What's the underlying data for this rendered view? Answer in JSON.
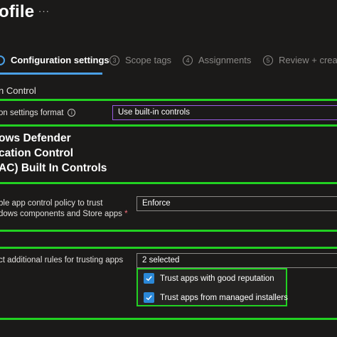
{
  "header": {
    "title": "ofile",
    "more_icon": "ellipsis-icon"
  },
  "steps": [
    {
      "number": "",
      "label": "Configuration settings",
      "active": true
    },
    {
      "number": "3",
      "label": "Scope tags"
    },
    {
      "number": "4",
      "label": "Assignments"
    },
    {
      "number": "5",
      "label": "Review + create"
    }
  ],
  "section": {
    "label": "n Control"
  },
  "format_field": {
    "label": "on settings format",
    "info_icon": "info-icon",
    "value": "Use built-in controls"
  },
  "heading": {
    "line1": "ows Defender",
    "line2": "cation Control",
    "line3": "AC) Built In Controls"
  },
  "enable_field": {
    "line1": "ble app control policy to trust",
    "line2": "dows components and Store apps",
    "required": "*",
    "value": "Enforce"
  },
  "rules_field": {
    "label": "ct additional rules for trusting apps",
    "value": "2 selected"
  },
  "options": [
    {
      "label": "Trust apps with good reputation",
      "checked": true
    },
    {
      "label": "Trust apps from managed installers",
      "checked": true
    }
  ],
  "colors": {
    "accent": "#2b88d8",
    "highlight": "#22d122",
    "focus_border": "#9b5de5",
    "background": "#1b1a19"
  }
}
